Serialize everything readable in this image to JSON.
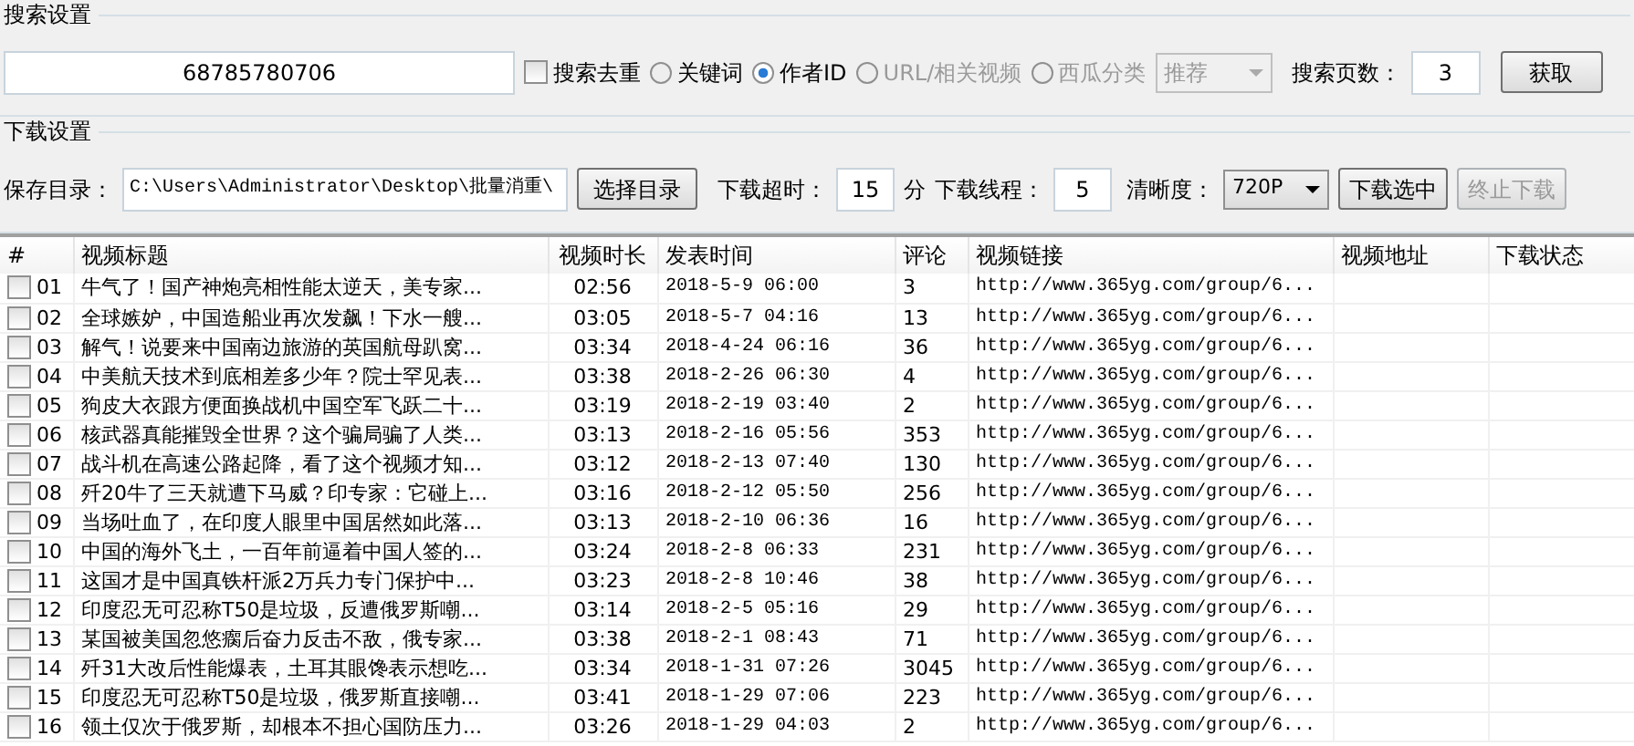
{
  "search_settings": {
    "title": "搜索设置",
    "query": "68785780706",
    "dedupe": {
      "label": "搜索去重",
      "checked": false
    },
    "modes": [
      {
        "label": "关键词",
        "selected": false,
        "disabled": false
      },
      {
        "label": "作者ID",
        "selected": true,
        "disabled": false
      },
      {
        "label": "URL/相关视频",
        "selected": false,
        "disabled": true
      },
      {
        "label": "西瓜分类",
        "selected": false,
        "disabled": true
      }
    ],
    "category": {
      "value": "推荐",
      "disabled": true
    },
    "pages_label": "搜索页数：",
    "pages": "3",
    "fetch_button": "获取"
  },
  "download_settings": {
    "title": "下载设置",
    "dir_label": "保存目录：",
    "dir": "C:\\Users\\Administrator\\Desktop\\批量消重\\",
    "choose_button": "选择目录",
    "timeout_label": "下载超时：",
    "timeout": "15",
    "timeout_unit": "分",
    "threads_label": "下载线程：",
    "threads": "5",
    "quality_label": "清晰度：",
    "quality": "720P",
    "buttons": [
      {
        "label": "下载选中",
        "disabled": false
      },
      {
        "label": "终止下载",
        "disabled": true
      }
    ]
  },
  "table": {
    "columns": [
      "#",
      "视频标题",
      "视频时长",
      "发表时间",
      "评论",
      "视频链接",
      "视频地址",
      "下载状态"
    ],
    "rows": [
      {
        "checked": false,
        "num": "01",
        "title": "牛气了！国产神炮亮相性能太逆天，美专家...",
        "duration": "02:56",
        "time": "2018-5-9 06:00",
        "comments": "3",
        "link": "http://www.365yg.com/group/6..."
      },
      {
        "checked": false,
        "num": "02",
        "title": "全球嫉妒，中国造船业再次发飙！下水一艘...",
        "duration": "03:05",
        "time": "2018-5-7 04:16",
        "comments": "13",
        "link": "http://www.365yg.com/group/6..."
      },
      {
        "checked": false,
        "num": "03",
        "title": "解气！说要来中国南边旅游的英国航母趴窝...",
        "duration": "03:34",
        "time": "2018-4-24 06:16",
        "comments": "36",
        "link": "http://www.365yg.com/group/6..."
      },
      {
        "checked": false,
        "num": "04",
        "title": "中美航天技术到底相差多少年？院士罕见表...",
        "duration": "03:38",
        "time": "2018-2-26 06:30",
        "comments": "4",
        "link": "http://www.365yg.com/group/6..."
      },
      {
        "checked": false,
        "num": "05",
        "title": "狗皮大衣跟方便面换战机中国空军飞跃二十...",
        "duration": "03:19",
        "time": "2018-2-19 03:40",
        "comments": "2",
        "link": "http://www.365yg.com/group/6..."
      },
      {
        "checked": false,
        "num": "06",
        "title": "核武器真能摧毁全世界？这个骗局骗了人类...",
        "duration": "03:13",
        "time": "2018-2-16 05:56",
        "comments": "353",
        "link": "http://www.365yg.com/group/6..."
      },
      {
        "checked": false,
        "num": "07",
        "title": "战斗机在高速公路起降，看了这个视频才知...",
        "duration": "03:12",
        "time": "2018-2-13 07:40",
        "comments": "130",
        "link": "http://www.365yg.com/group/6..."
      },
      {
        "checked": false,
        "num": "08",
        "title": "歼20牛了三天就遭下马威？印专家：它碰上...",
        "duration": "03:16",
        "time": "2018-2-12 05:50",
        "comments": "256",
        "link": "http://www.365yg.com/group/6..."
      },
      {
        "checked": false,
        "num": "09",
        "title": "当场吐血了，在印度人眼里中国居然如此落...",
        "duration": "03:13",
        "time": "2018-2-10 06:36",
        "comments": "16",
        "link": "http://www.365yg.com/group/6..."
      },
      {
        "checked": false,
        "num": "10",
        "title": "中国的海外飞土，一百年前逼着中国人签的...",
        "duration": "03:24",
        "time": "2018-2-8 06:33",
        "comments": "231",
        "link": "http://www.365yg.com/group/6..."
      },
      {
        "checked": false,
        "num": "11",
        "title": "这国才是中国真铁杆派2万兵力专门保护中...",
        "duration": "03:23",
        "time": "2018-2-8 10:46",
        "comments": "38",
        "link": "http://www.365yg.com/group/6..."
      },
      {
        "checked": false,
        "num": "12",
        "title": "印度忍无可忍称T50是垃圾，反遭俄罗斯嘲...",
        "duration": "03:14",
        "time": "2018-2-5 05:16",
        "comments": "29",
        "link": "http://www.365yg.com/group/6..."
      },
      {
        "checked": false,
        "num": "13",
        "title": "某国被美国忽悠瘸后奋力反击不敌，俄专家...",
        "duration": "03:38",
        "time": "2018-2-1 08:43",
        "comments": "71",
        "link": "http://www.365yg.com/group/6..."
      },
      {
        "checked": false,
        "num": "14",
        "title": "歼31大改后性能爆表，土耳其眼馋表示想吃...",
        "duration": "03:34",
        "time": "2018-1-31 07:26",
        "comments": "3045",
        "link": "http://www.365yg.com/group/6..."
      },
      {
        "checked": false,
        "num": "15",
        "title": "印度忍无可忍称T50是垃圾，俄罗斯直接嘲...",
        "duration": "03:41",
        "time": "2018-1-29 07:06",
        "comments": "223",
        "link": "http://www.365yg.com/group/6..."
      },
      {
        "checked": false,
        "num": "16",
        "title": "领土仅次于俄罗斯，却根本不担心国防压力...",
        "duration": "03:26",
        "time": "2018-1-29 04:03",
        "comments": "2",
        "link": "http://www.365yg.com/group/6..."
      }
    ]
  }
}
